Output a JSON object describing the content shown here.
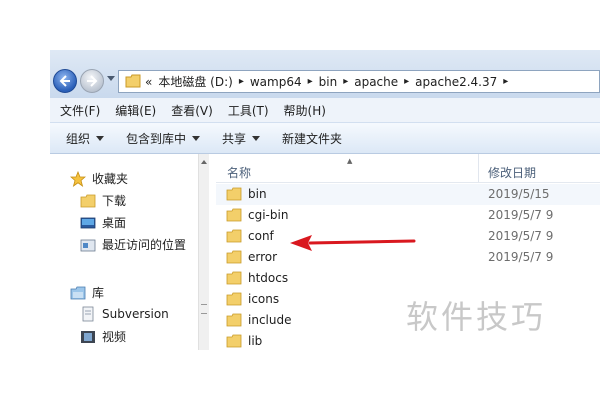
{
  "address": {
    "chevron": "«",
    "crumbs": [
      "本地磁盘 (D:)",
      "wamp64",
      "bin",
      "apache",
      "apache2.4.37"
    ],
    "separator": "▸"
  },
  "menu": [
    "文件(F)",
    "编辑(E)",
    "查看(V)",
    "工具(T)",
    "帮助(H)"
  ],
  "toolbar": {
    "organize": "组织",
    "include_library": "包含到库中",
    "share": "共享",
    "new_folder": "新建文件夹"
  },
  "navpane": {
    "favorites": "收藏夹",
    "downloads": "下载",
    "desktop": "桌面",
    "recent": "最近访问的位置",
    "libraries": "库",
    "subversion": "Subversion",
    "videos": "视频"
  },
  "columns": {
    "name": "名称",
    "date": "修改日期"
  },
  "files": [
    {
      "name": "bin",
      "date": "2019/5/15"
    },
    {
      "name": "cgi-bin",
      "date": "2019/5/7 9"
    },
    {
      "name": "conf",
      "date": "2019/5/7 9"
    },
    {
      "name": "error",
      "date": "2019/5/7 9"
    },
    {
      "name": "htdocs",
      "date": ""
    },
    {
      "name": "icons",
      "date": ""
    },
    {
      "name": "include",
      "date": ""
    },
    {
      "name": "lib",
      "date": ""
    }
  ],
  "annotation": {
    "color": "#d9181f",
    "points_to": "conf"
  },
  "watermark": "软件技巧"
}
